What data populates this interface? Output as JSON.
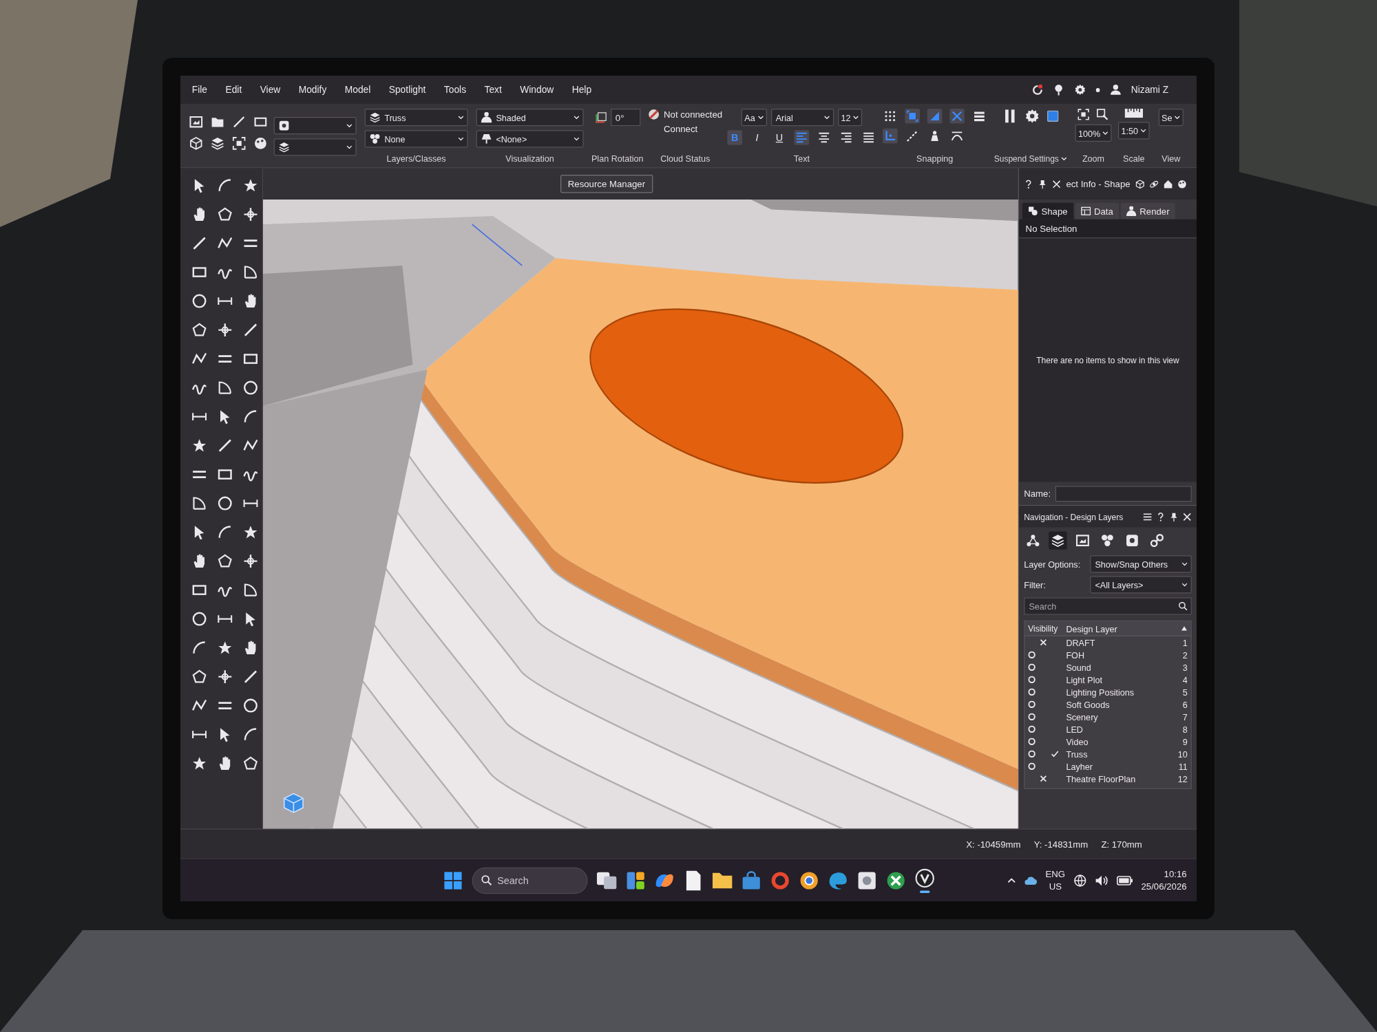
{
  "menu_bar": {
    "items": [
      "File",
      "Edit",
      "View",
      "Modify",
      "Model",
      "Spotlight",
      "Tools",
      "Text",
      "Window",
      "Help"
    ],
    "user": "Nizami Z"
  },
  "view_bar": {
    "groups": [
      {
        "kind": "layer_class",
        "label": "Layers/Classes",
        "fields": [
          "Truss",
          "None"
        ]
      },
      {
        "kind": "visualization",
        "label": "Visualization",
        "fields": [
          "Shaded",
          "<None>"
        ]
      },
      {
        "kind": "rotation",
        "label": "Plan Rotation",
        "value": "0°"
      },
      {
        "kind": "cloud",
        "label": "Cloud Status",
        "status": "Not connected",
        "action": "Connect"
      },
      {
        "kind": "text",
        "label": "Text",
        "case_menu": "Aa",
        "font": "Arial",
        "size": "12",
        "styles": [
          {
            "kind": "bold",
            "label": "B",
            "on": true
          },
          {
            "kind": "italic",
            "label": "I",
            "on": false
          },
          {
            "kind": "underline",
            "label": "U",
            "on": false
          }
        ],
        "alignments": [
          {
            "kind": "left",
            "selected": true
          },
          {
            "kind": "center",
            "selected": false
          },
          {
            "kind": "right",
            "selected": false
          },
          {
            "kind": "justify",
            "selected": false
          }
        ]
      },
      {
        "kind": "snapping",
        "label": "Snapping",
        "snaps": [
          {
            "kind": "grid",
            "on": false
          },
          {
            "kind": "object",
            "on": true
          },
          {
            "kind": "angle",
            "on": true
          },
          {
            "kind": "intersection",
            "on": true
          },
          {
            "kind": "edge",
            "on": true
          },
          {
            "kind": "distance",
            "on": false
          },
          {
            "kind": "smart-point",
            "on": false
          },
          {
            "kind": "tangent",
            "on": false
          }
        ]
      },
      {
        "kind": "suspend",
        "label": "Suspend Settings"
      },
      {
        "kind": "zoom",
        "label": "Zoom",
        "value": "100%"
      },
      {
        "kind": "scale",
        "label": "Scale",
        "value": "1:50"
      },
      {
        "kind": "view",
        "label": "View",
        "value": "Se"
      }
    ]
  },
  "drawing_header": {
    "resource_manager": "Resource Manager"
  },
  "object_info": {
    "title": "ect Info - Shape",
    "tabs": [
      {
        "kind": "shape",
        "label": "Shape",
        "selected": true
      },
      {
        "kind": "data",
        "label": "Data",
        "selected": false
      },
      {
        "kind": "render",
        "label": "Render",
        "selected": false
      }
    ],
    "selection": "No Selection",
    "message": "There are no items to show in this view",
    "name_label": "Name:"
  },
  "navigation": {
    "title": "Navigation - Design Layers",
    "tabs": [
      {
        "kind": "nodes",
        "selected": false
      },
      {
        "kind": "layers",
        "selected": true
      },
      {
        "kind": "sheets",
        "selected": false
      },
      {
        "kind": "classes",
        "selected": false
      },
      {
        "kind": "viewports",
        "selected": false
      },
      {
        "kind": "references",
        "selected": false
      }
    ],
    "options": [
      {
        "label": "Layer Options:",
        "value": "Show/Snap Others"
      },
      {
        "label": "Filter:",
        "value": "<All Layers>"
      }
    ],
    "search": {
      "placeholder": "Search"
    },
    "columns": [
      "Visibility",
      "Design Layer"
    ],
    "layers": [
      {
        "name": "DRAFT",
        "number": "1",
        "visible": false,
        "active": false
      },
      {
        "name": "FOH",
        "number": "2",
        "visible": true,
        "active": false
      },
      {
        "name": "Sound",
        "number": "3",
        "visible": true,
        "active": false
      },
      {
        "name": "Light Plot",
        "number": "4",
        "visible": true,
        "active": false
      },
      {
        "name": "Lighting Positions",
        "number": "5",
        "visible": true,
        "active": false
      },
      {
        "name": "Soft Goods",
        "number": "6",
        "visible": true,
        "active": false
      },
      {
        "name": "Scenery",
        "number": "7",
        "visible": true,
        "active": false
      },
      {
        "name": "LED",
        "number": "8",
        "visible": true,
        "active": false
      },
      {
        "name": "Video",
        "number": "9",
        "visible": true,
        "active": false
      },
      {
        "name": "Truss",
        "number": "10",
        "visible": true,
        "active": true
      },
      {
        "name": "Layher",
        "number": "11",
        "visible": true,
        "active": false
      },
      {
        "name": "Theatre FloorPlan",
        "number": "12",
        "visible": false,
        "active": false
      }
    ]
  },
  "status_bar": {
    "coordinates": [
      "X: -10459mm",
      "Y: -14831mm",
      "Z: 170mm"
    ]
  },
  "taskbar": {
    "search": {
      "placeholder": "Search"
    },
    "apps": [
      {
        "kind": "taskview",
        "selected": false
      },
      {
        "kind": "widgets",
        "selected": false
      },
      {
        "kind": "copilot",
        "selected": false
      },
      {
        "kind": "notes",
        "selected": false
      },
      {
        "kind": "folder",
        "selected": false
      },
      {
        "kind": "store",
        "selected": false
      },
      {
        "kind": "ring",
        "selected": false
      },
      {
        "kind": "browser",
        "selected": false
      },
      {
        "kind": "edge",
        "selected": false
      },
      {
        "kind": "photos",
        "selected": false
      },
      {
        "kind": "xbox",
        "selected": false
      },
      {
        "kind": "vectorworks",
        "selected": true
      }
    ],
    "tray": {
      "language": "ENG",
      "region": "US",
      "time": "10:16",
      "date": "25/06/2026"
    }
  }
}
